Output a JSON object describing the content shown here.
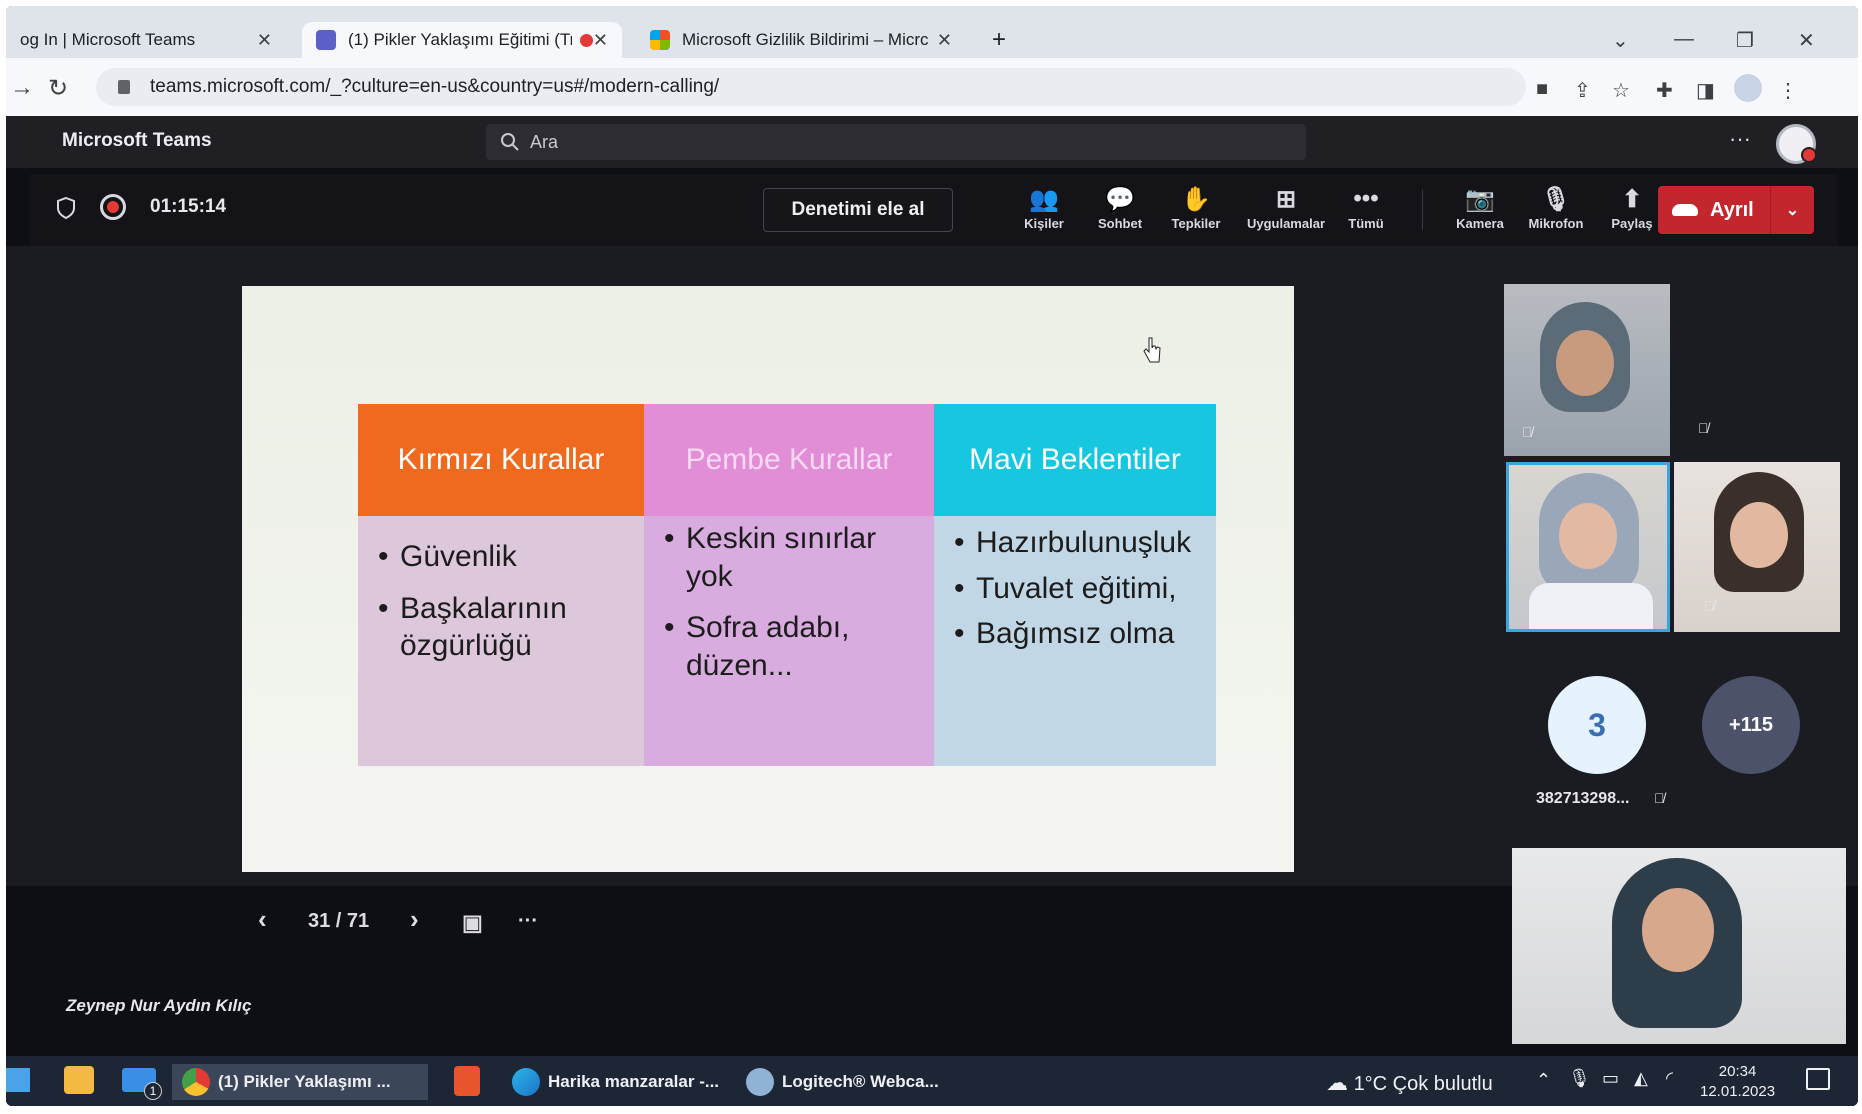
{
  "browser": {
    "tabs": [
      {
        "title": "og In | Microsoft Teams",
        "active": false
      },
      {
        "title": "(1) Pikler Yaklaşımı Eğitimi (Tr",
        "active": true,
        "recording": true
      },
      {
        "title": "Microsoft Gizlilik Bildirimi – Micrc",
        "active": false
      }
    ],
    "new_tab": "+",
    "url": "teams.microsoft.com/_?culture=en-us&country=us#/modern-calling/"
  },
  "teams": {
    "brand": "Microsoft Teams",
    "search_placeholder": "Ara"
  },
  "meeting": {
    "timer": "01:15:14",
    "take_control": "Denetimi ele al",
    "tools": [
      "Kişiler",
      "Sohbet",
      "Tepkiler",
      "Uygulamalar",
      "Tümü",
      "Kamera",
      "Mikrofon",
      "Paylaş"
    ],
    "leave": "Ayrıl"
  },
  "slide": {
    "columns": [
      {
        "header": "Kırmızı Kurallar",
        "items": [
          "Güvenlik",
          "Başkalarının özgürlüğü"
        ],
        "head_color": "#ef6a1e",
        "body_color": "#dcc7db",
        "head_text_color": "#ffffff"
      },
      {
        "header": "Pembe Kurallar",
        "items": [
          "Keskin sınırlar yok",
          "Sofra adabı, düzen..."
        ],
        "head_color": "#e18ed6",
        "body_color": "#d8acde",
        "head_text_color": "#f7d9f1"
      },
      {
        "header": "Mavi Beklentiler",
        "items": [
          "Hazırbulunuşluk",
          "Tuvalet eğitimi,",
          "Bağımsız olma"
        ],
        "head_color": "#16c7df",
        "body_color": "#c2d7e6",
        "head_text_color": "#ffffff"
      }
    ],
    "page": "31 / 71",
    "presenter": "Zeynep Nur Aydın Kılıç"
  },
  "participants": {
    "count_bubble": "3",
    "more_bubble": "+115",
    "bubble_label": "382713298..."
  },
  "taskbar": {
    "apps": [
      "(1) Pikler Yaklaşımı ...",
      "Harika manzaralar -...",
      "Logitech® Webca..."
    ],
    "mail_badge": "1",
    "weather": "1°C  Çok bulutlu",
    "time": "20:34",
    "date": "12.01.2023"
  }
}
